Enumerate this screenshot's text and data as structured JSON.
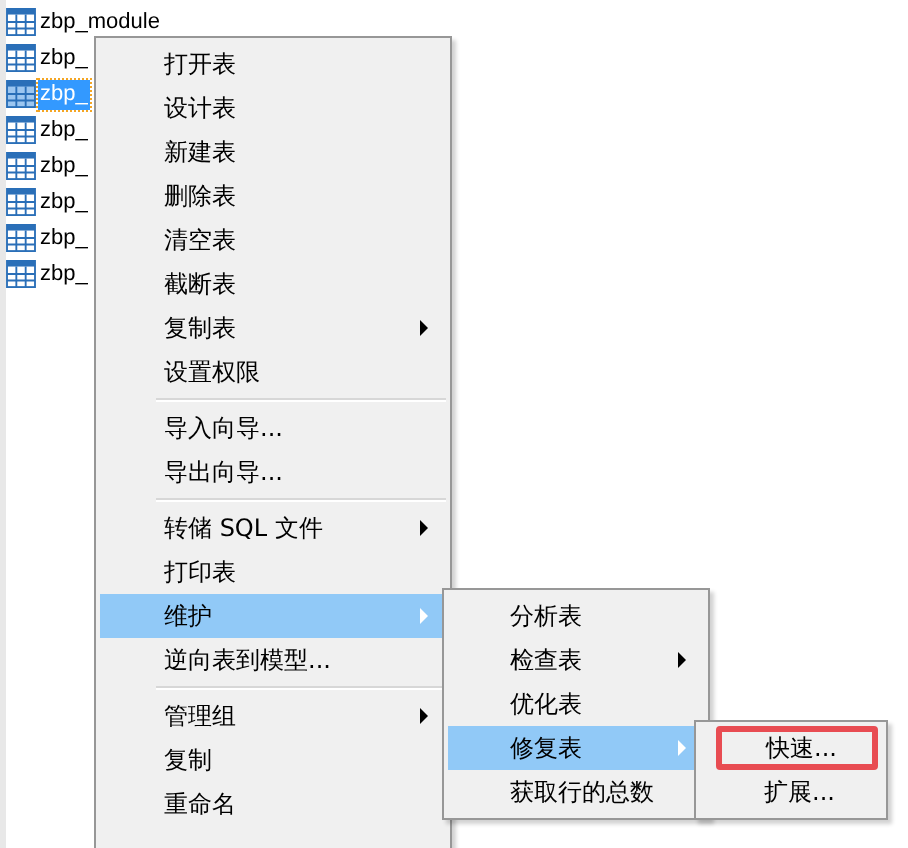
{
  "tree": {
    "items": [
      {
        "label": "zbp_module",
        "selected": false
      },
      {
        "label": "zbp_",
        "selected": false
      },
      {
        "label": "zbp_",
        "selected": true
      },
      {
        "label": "zbp_",
        "selected": false
      },
      {
        "label": "zbp_",
        "selected": false
      },
      {
        "label": "zbp_",
        "selected": false
      },
      {
        "label": "zbp_",
        "selected": false
      },
      {
        "label": "zbp_",
        "selected": false
      }
    ]
  },
  "context_menu": {
    "items": [
      {
        "kind": "item",
        "label": "打开表",
        "has_submenu": false,
        "selected": false
      },
      {
        "kind": "item",
        "label": "设计表",
        "has_submenu": false,
        "selected": false
      },
      {
        "kind": "item",
        "label": "新建表",
        "has_submenu": false,
        "selected": false
      },
      {
        "kind": "item",
        "label": "删除表",
        "has_submenu": false,
        "selected": false
      },
      {
        "kind": "item",
        "label": "清空表",
        "has_submenu": false,
        "selected": false
      },
      {
        "kind": "item",
        "label": "截断表",
        "has_submenu": false,
        "selected": false
      },
      {
        "kind": "item",
        "label": "复制表",
        "has_submenu": true,
        "selected": false
      },
      {
        "kind": "item",
        "label": "设置权限",
        "has_submenu": false,
        "selected": false
      },
      {
        "kind": "separator"
      },
      {
        "kind": "item",
        "label": "导入向导...",
        "has_submenu": false,
        "selected": false
      },
      {
        "kind": "item",
        "label": "导出向导...",
        "has_submenu": false,
        "selected": false
      },
      {
        "kind": "separator"
      },
      {
        "kind": "item",
        "label": "转储 SQL 文件",
        "has_submenu": true,
        "selected": false
      },
      {
        "kind": "item",
        "label": "打印表",
        "has_submenu": false,
        "selected": false
      },
      {
        "kind": "item",
        "label": "维护",
        "has_submenu": true,
        "selected": true
      },
      {
        "kind": "item",
        "label": "逆向表到模型...",
        "has_submenu": false,
        "selected": false
      },
      {
        "kind": "separator"
      },
      {
        "kind": "item",
        "label": "管理组",
        "has_submenu": true,
        "selected": false
      },
      {
        "kind": "item",
        "label": "复制",
        "has_submenu": false,
        "selected": false
      },
      {
        "kind": "item",
        "label": "重命名",
        "has_submenu": false,
        "selected": false
      }
    ]
  },
  "maintenance_submenu": {
    "items": [
      {
        "kind": "item",
        "label": "分析表",
        "has_submenu": false,
        "selected": false
      },
      {
        "kind": "item",
        "label": "检查表",
        "has_submenu": true,
        "selected": false
      },
      {
        "kind": "item",
        "label": "优化表",
        "has_submenu": false,
        "selected": false
      },
      {
        "kind": "item",
        "label": "修复表",
        "has_submenu": true,
        "selected": true
      },
      {
        "kind": "item",
        "label": "获取行的总数",
        "has_submenu": false,
        "selected": false
      }
    ]
  },
  "repair_submenu": {
    "items": [
      {
        "kind": "item",
        "label": "快速...",
        "has_submenu": false,
        "selected": false,
        "annotated": true
      },
      {
        "kind": "item",
        "label": "扩展...",
        "has_submenu": false,
        "selected": false,
        "annotated": false
      }
    ]
  }
}
